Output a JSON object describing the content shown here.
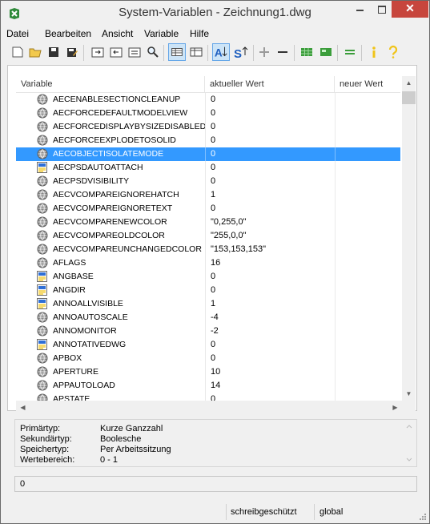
{
  "window": {
    "title": "System-Variablen - Zeichnung1.dwg",
    "close_glyph": "✕"
  },
  "menu": [
    "Datei",
    "Bearbeiten",
    "Ansicht",
    "Variable",
    "Hilfe"
  ],
  "columns": {
    "variable": "Variable",
    "current": "aktueller Wert",
    "new": "neuer Wert"
  },
  "rows": [
    {
      "name": "AECENABLESECTIONCLEANUP",
      "value": "0",
      "icon": "globe-icon"
    },
    {
      "name": "AECFORCEDEFAULTMODELVIEW",
      "value": "0",
      "icon": "globe-icon"
    },
    {
      "name": "AECFORCEDISPLAYBYSIZEDISABLED",
      "value": "0",
      "icon": "globe-icon"
    },
    {
      "name": "AECFORCEEXPLODETOSOLID",
      "value": "0",
      "icon": "globe-icon"
    },
    {
      "name": "AECOBJECTISOLATEMODE",
      "value": "0",
      "icon": "globe-icon"
    },
    {
      "name": "AECPSDAUTOATTACH",
      "value": "0",
      "icon": "document-icon"
    },
    {
      "name": "AECPSDVISIBILITY",
      "value": "0",
      "icon": "globe-icon"
    },
    {
      "name": "AECVCOMPAREIGNOREHATCH",
      "value": "1",
      "icon": "globe-icon"
    },
    {
      "name": "AECVCOMPAREIGNORETEXT",
      "value": "0",
      "icon": "globe-icon"
    },
    {
      "name": "AECVCOMPARENEWCOLOR",
      "value": "\"0,255,0\"",
      "icon": "globe-icon"
    },
    {
      "name": "AECVCOMPAREOLDCOLOR",
      "value": "\"255,0,0\"",
      "icon": "globe-icon"
    },
    {
      "name": "AECVCOMPAREUNCHANGEDCOLOR",
      "value": "\"153,153,153\"",
      "icon": "globe-icon"
    },
    {
      "name": "AFLAGS",
      "value": "16",
      "icon": "globe-icon"
    },
    {
      "name": "ANGBASE",
      "value": "0",
      "icon": "document-icon"
    },
    {
      "name": "ANGDIR",
      "value": "0",
      "icon": "document-icon"
    },
    {
      "name": "ANNOALLVISIBLE",
      "value": "1",
      "icon": "document-icon"
    },
    {
      "name": "ANNOAUTOSCALE",
      "value": "-4",
      "icon": "globe-icon"
    },
    {
      "name": "ANNOMONITOR",
      "value": "-2",
      "icon": "globe-icon"
    },
    {
      "name": "ANNOTATIVEDWG",
      "value": "0",
      "icon": "document-icon"
    },
    {
      "name": "APBOX",
      "value": "0",
      "icon": "globe-icon"
    },
    {
      "name": "APERTURE",
      "value": "10",
      "icon": "globe-icon"
    },
    {
      "name": "APPAUTOLOAD",
      "value": "14",
      "icon": "globe-icon"
    },
    {
      "name": "APSTATE",
      "value": "0",
      "icon": "globe-icon"
    }
  ],
  "selected_variable": "AECOBJECTISOLATEMODE",
  "info": [
    {
      "label": "Primärtyp:",
      "value": "Kurze Ganzzahl"
    },
    {
      "label": "Sekundärtyp:",
      "value": "Boolesche"
    },
    {
      "label": "Speichertyp:",
      "value": "Per Arbeitssitzung"
    },
    {
      "label": "Wertebereich:",
      "value": "0 - 1"
    }
  ],
  "value_field": "0",
  "status": {
    "readonly": "schreibgeschützt",
    "scope": "global"
  },
  "colors": {
    "selection": "#3399ff",
    "close": "#c7463d",
    "accent_green": "#3b9d3b",
    "accent_yellow": "#f0c419"
  },
  "toolbar_icons": [
    "new-icon",
    "open-icon",
    "save-icon",
    "save-as-icon",
    "export-icon",
    "import-icon",
    "compare-icon",
    "find-icon",
    "view-list-icon",
    "view-detail-icon",
    "sort-alpha-icon",
    "sort-type-icon",
    "add-icon",
    "remove-icon",
    "grid-icon",
    "table-icon",
    "equals-icon",
    "info-icon",
    "help-icon"
  ]
}
